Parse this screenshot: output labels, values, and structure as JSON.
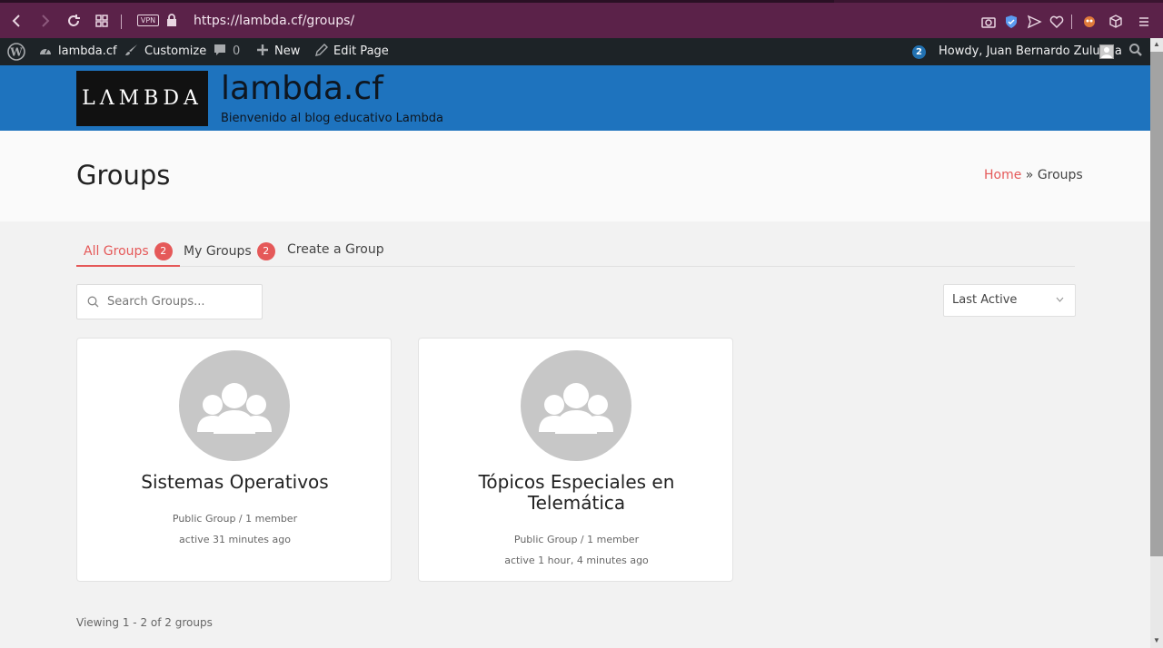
{
  "browser": {
    "url": "https://lambda.cf/groups/",
    "vpn_label": "VPN"
  },
  "admin_bar": {
    "site_name": "lambda.cf",
    "customize": "Customize",
    "comments_count": "0",
    "new": "New",
    "edit_page": "Edit Page",
    "notifications": "2",
    "howdy": "Howdy, Juan Bernardo Zuluaga"
  },
  "site": {
    "logo_text": "LΛMBDA",
    "title": "lambda.cf",
    "tagline": "Bienvenido al blog educativo Lambda"
  },
  "page": {
    "title": "Groups",
    "breadcrumb_home": "Home",
    "breadcrumb_sep": " » ",
    "breadcrumb_current": "Groups"
  },
  "tabs": [
    {
      "label": "All Groups",
      "count": "2"
    },
    {
      "label": "My Groups",
      "count": "2"
    },
    {
      "label": "Create a Group"
    }
  ],
  "search": {
    "placeholder": "Search Groups..."
  },
  "sort": {
    "selected": "Last Active"
  },
  "groups": [
    {
      "name": "Sistemas Operativos",
      "type": "Public Group / 1 member",
      "active": "active 31 minutes ago"
    },
    {
      "name": "Tópicos Especiales en Telemática",
      "type": "Public Group / 1 member",
      "active": "active 1 hour, 4 minutes ago"
    }
  ],
  "footer": {
    "count_text": "Viewing 1 - 2 of 2 groups"
  },
  "colors": {
    "accent": "#e55959",
    "header_blue": "#1e73be",
    "browser": "#5b2249",
    "admin_bar": "#1d2327"
  }
}
